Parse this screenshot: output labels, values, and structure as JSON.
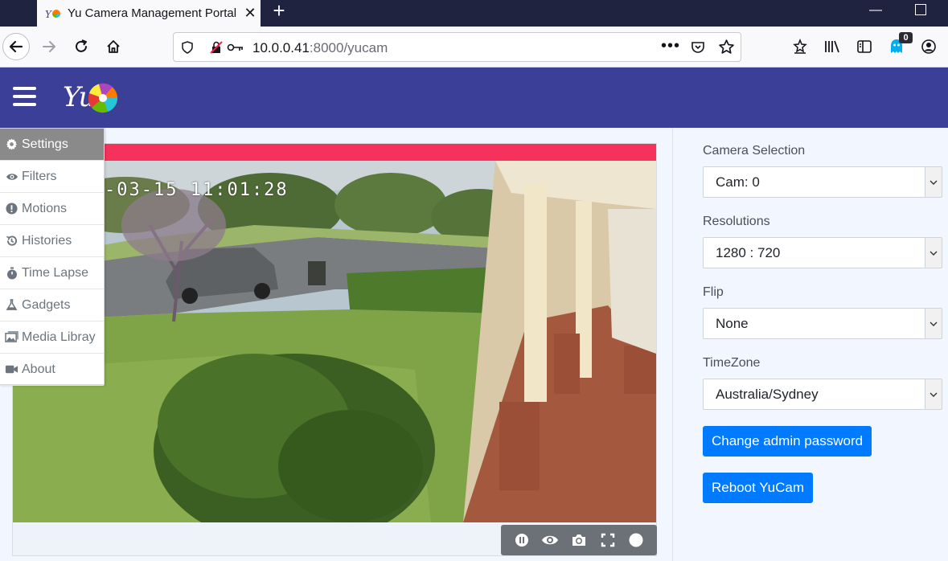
{
  "browser": {
    "tab_title": "Yu Camera Management Portal",
    "url_host": "10.0.0.41",
    "url_rest": ":8000/yucam",
    "extension_badge": "0"
  },
  "menu": {
    "items": [
      {
        "label": "Settings",
        "icon": "gear-icon",
        "active": true
      },
      {
        "label": "Filters",
        "icon": "eye-icon"
      },
      {
        "label": "Motions",
        "icon": "alert-circle-icon"
      },
      {
        "label": "Histories",
        "icon": "history-icon"
      },
      {
        "label": "Time Lapse",
        "icon": "stopwatch-icon"
      },
      {
        "label": "Gadgets",
        "icon": "flask-icon"
      },
      {
        "label": "Media Libray",
        "icon": "images-icon"
      },
      {
        "label": "About",
        "icon": "video-icon"
      }
    ]
  },
  "video": {
    "timestamp": "-03-15 11:01:28",
    "record_bar_color": "#f5325b"
  },
  "settings": {
    "camera_label": "Camera Selection",
    "camera_value": "Cam: 0",
    "resolution_label": "Resolutions",
    "resolution_value": "1280 : 720",
    "flip_label": "Flip",
    "flip_value": "None",
    "timezone_label": "TimeZone",
    "timezone_value": "Australia/Sydney",
    "change_password_label": "Change admin password",
    "reboot_label": "Reboot YuCam"
  },
  "colors": {
    "header": "#3c3f98",
    "primary_button": "#007bff",
    "active_menu": "#8a8a8a"
  }
}
